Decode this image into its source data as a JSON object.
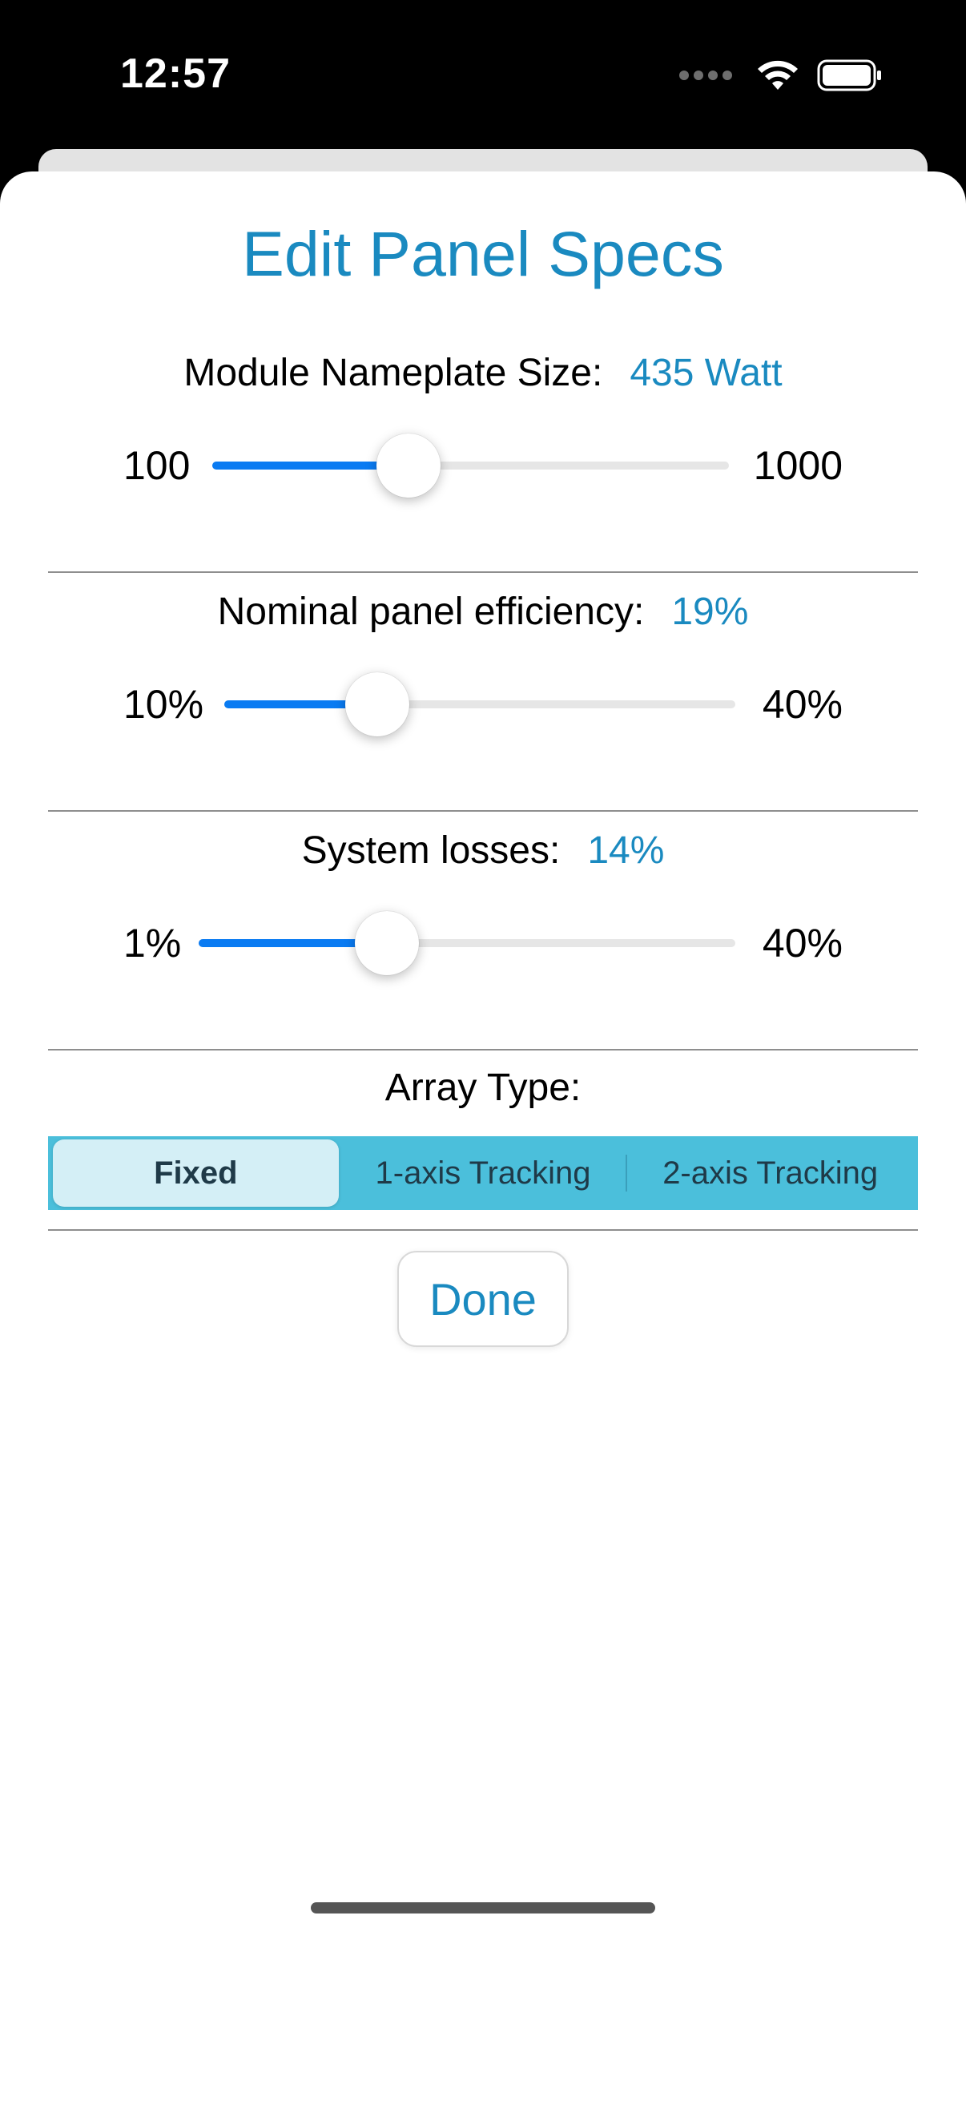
{
  "status_bar": {
    "time": "12:57",
    "icons": [
      "cellular-dots-icon",
      "wifi-icon",
      "battery-icon"
    ]
  },
  "sheet": {
    "title": "Edit Panel Specs",
    "module_size": {
      "label": "Module Nameplate Size:",
      "value": "435 Watt",
      "min_label": "100",
      "max_label": "1000",
      "fraction": 0.38
    },
    "efficiency": {
      "label": "Nominal panel efficiency:",
      "value": "19%",
      "min_label": "10%",
      "max_label": "40%",
      "fraction": 0.3
    },
    "losses": {
      "label": "System losses:",
      "value": "14%",
      "min_label": "1%",
      "max_label": "40%",
      "fraction": 0.35
    },
    "array_type": {
      "label": "Array Type:",
      "options": [
        "Fixed",
        "1-axis Tracking",
        "2-axis Tracking"
      ],
      "selected": "Fixed"
    },
    "done_label": "Done"
  },
  "colors": {
    "accent": "#1a8ac0",
    "slider_fill": "#0a7bf2",
    "segment_bg": "#4bbfdb",
    "segment_selected": "#d4eff6"
  }
}
